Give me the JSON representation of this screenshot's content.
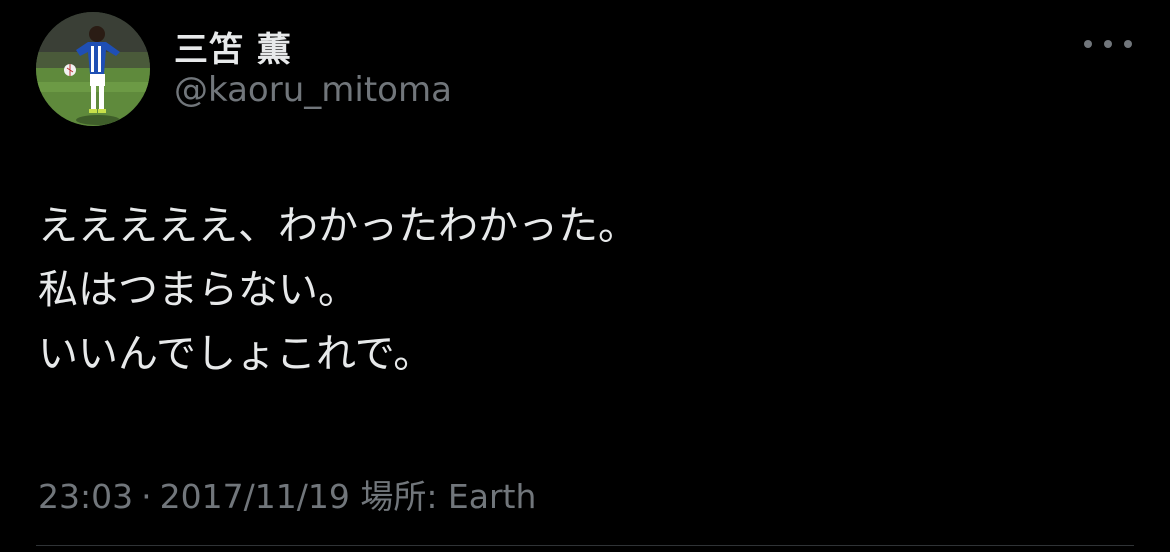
{
  "author": {
    "display_name": "三笘 薫",
    "handle": "@kaoru_mitoma",
    "avatar_icon": "profile-photo-soccer-player"
  },
  "more_icon": "more-horizontal-icon",
  "tweet": {
    "lines": [
      "えええええ、わかったわかった。",
      "私はつまらない。",
      "いいんでしょこれで。"
    ]
  },
  "meta": {
    "time": "23:03",
    "separator": "·",
    "date": "2017/11/19",
    "location": "場所: Earth"
  },
  "colors": {
    "background": "#000000",
    "primary_text": "#e7e9ea",
    "secondary_text": "#71767b",
    "divider": "#2f3336"
  }
}
